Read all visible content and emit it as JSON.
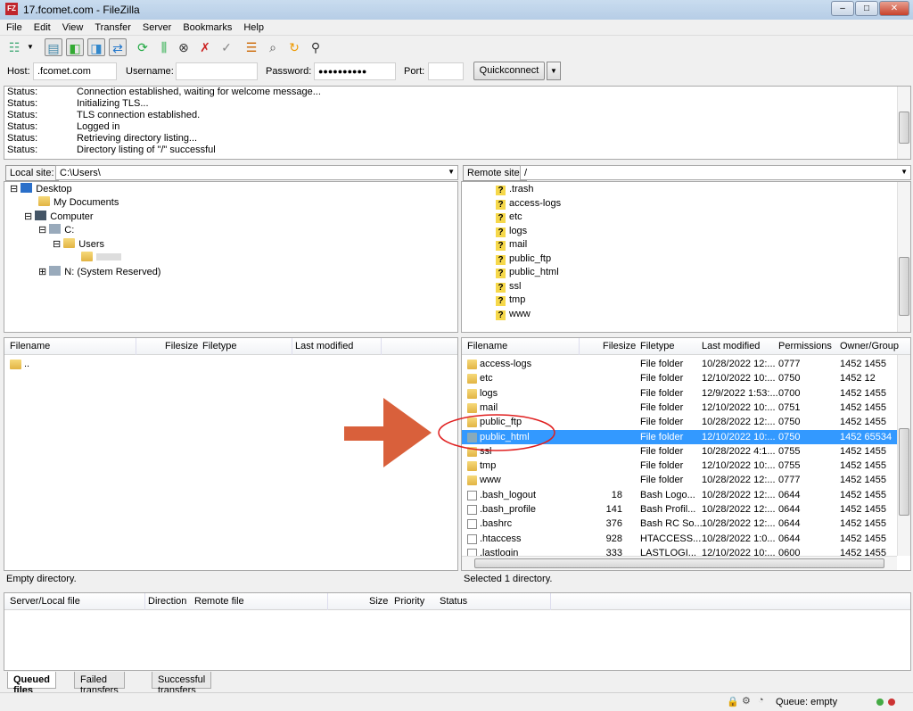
{
  "window": {
    "title": "17.fcomet.com - FileZilla",
    "logo": "FZ",
    "minimize": "–",
    "maximize": "□",
    "close": "✕"
  },
  "menu": [
    "File",
    "Edit",
    "View",
    "Transfer",
    "Server",
    "Bookmarks",
    "Help"
  ],
  "toolbar": [
    "site-manager",
    "toggle-log",
    "toggle-local-tree",
    "toggle-remote-tree",
    "toggle-queue",
    "refresh",
    "process-queue",
    "cancel",
    "disconnect",
    "reconnect",
    "filter",
    "compare",
    "sync-browse",
    "search"
  ],
  "quickconnect": {
    "host_label": "Host:",
    "host": ".fcomet.com",
    "user_label": "Username:",
    "user": "",
    "pass_label": "Password:",
    "pass": "●●●●●●●●●●",
    "port_label": "Port:",
    "port": "",
    "button": "Quickconnect"
  },
  "log": [
    [
      "Status:",
      "Connection established, waiting for welcome message..."
    ],
    [
      "Status:",
      "Initializing TLS..."
    ],
    [
      "Status:",
      "TLS connection established."
    ],
    [
      "Status:",
      "Logged in"
    ],
    [
      "Status:",
      "Retrieving directory listing..."
    ],
    [
      "Status:",
      "Directory listing of \"/\" successful"
    ]
  ],
  "local": {
    "site_label": "Local site:",
    "path": "C:\\Users\\",
    "tree": [
      "Desktop",
      "My Documents",
      "Computer",
      "C:",
      "Users",
      "",
      "N: (System Reserved)"
    ],
    "columns": [
      "Filename",
      "Filesize",
      "Filetype",
      "Last modified"
    ],
    "files": [
      ".."
    ],
    "status": "Empty directory."
  },
  "remote": {
    "site_label": "Remote site:",
    "path": "/",
    "tree": [
      ".trash",
      "access-logs",
      "etc",
      "logs",
      "mail",
      "public_ftp",
      "public_html",
      "ssl",
      "tmp",
      "www"
    ],
    "columns": [
      "Filename",
      "Filesize",
      "Filetype",
      "Last modified",
      "Permissions",
      "Owner/Group"
    ],
    "files": [
      [
        "access-logs",
        "",
        "File folder",
        "10/28/2022 12:...",
        "0777",
        "1452 1455",
        "link"
      ],
      [
        "etc",
        "",
        "File folder",
        "12/10/2022 10:...",
        "0750",
        "1452 12",
        "folder"
      ],
      [
        "logs",
        "",
        "File folder",
        "12/9/2022 1:53:...",
        "0700",
        "1452 1455",
        "folder"
      ],
      [
        "mail",
        "",
        "File folder",
        "12/10/2022 10:...",
        "0751",
        "1452 1455",
        "folder"
      ],
      [
        "public_ftp",
        "",
        "File folder",
        "10/28/2022 12:...",
        "0750",
        "1452 1455",
        "folder"
      ],
      [
        "public_html",
        "",
        "File folder",
        "12/10/2022 10:...",
        "0750",
        "1452 65534",
        "folder"
      ],
      [
        "ssl",
        "",
        "File folder",
        "10/28/2022 4:1...",
        "0755",
        "1452 1455",
        "folder"
      ],
      [
        "tmp",
        "",
        "File folder",
        "12/10/2022 10:...",
        "0755",
        "1452 1455",
        "folder"
      ],
      [
        "www",
        "",
        "File folder",
        "10/28/2022 12:...",
        "0777",
        "1452 1455",
        "link"
      ],
      [
        ".bash_logout",
        "18",
        "Bash Logo...",
        "10/28/2022 12:...",
        "0644",
        "1452 1455",
        "file"
      ],
      [
        ".bash_profile",
        "141",
        "Bash Profil...",
        "10/28/2022 12:...",
        "0644",
        "1452 1455",
        "file"
      ],
      [
        ".bashrc",
        "376",
        "Bash RC So...",
        "10/28/2022 12:...",
        "0644",
        "1452 1455",
        "file"
      ],
      [
        ".htaccess",
        "928",
        "HTACCESS...",
        "10/28/2022 1:0...",
        "0644",
        "1452 1455",
        "file"
      ],
      [
        ".lastlogin",
        "333",
        "LASTLOGI...",
        "12/10/2022 10:...",
        "0600",
        "1452 1455",
        "file"
      ]
    ],
    "selected_index": 5,
    "status": "Selected 1 directory."
  },
  "queue": {
    "columns": [
      "Server/Local file",
      "Direction",
      "Remote file",
      "Size",
      "Priority",
      "Status"
    ],
    "tabs": [
      "Queued files",
      "Failed transfers",
      "Successful transfers"
    ],
    "status": "Queue: empty"
  },
  "colors": {
    "selection": "#3399ff",
    "arrow": "#d9603b",
    "ellipse": "#e02020"
  }
}
